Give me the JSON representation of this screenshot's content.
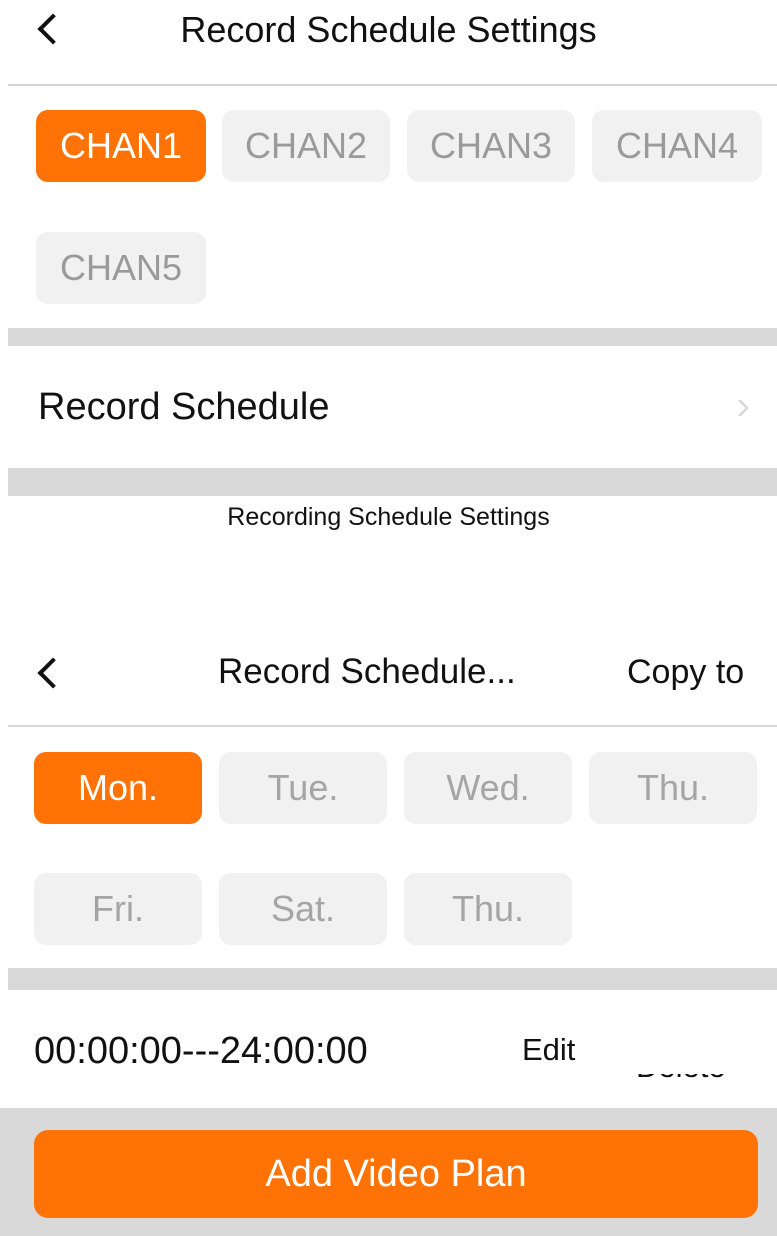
{
  "screen1": {
    "title": "Record Schedule Settings",
    "channels": [
      "CHAN1",
      "CHAN2",
      "CHAN3",
      "CHAN4",
      "CHAN5"
    ],
    "selected_channel": "CHAN1",
    "record_schedule_label": "Record Schedule"
  },
  "caption": "Recording Schedule Settings",
  "screen2": {
    "title": "Record Schedule...",
    "copy_to_label": "Copy to",
    "days": [
      "Mon.",
      "Tue.",
      "Wed.",
      "Thu.",
      "Fri.",
      "Sat.",
      "Thu."
    ],
    "selected_day": "Mon.",
    "schedule": {
      "time_range": "00:00:00---24:00:00",
      "edit_label": "Edit",
      "delete_label": "Delete"
    },
    "add_button_label": "Add Video Plan"
  },
  "colors": {
    "accent": "#ff7206",
    "chip_bg": "#f1f1f1",
    "chip_text": "#9a9a9a",
    "divider_band": "#d9d9d9"
  },
  "icons": {
    "back": "chevron-left-icon",
    "disclosure": "chevron-right-icon"
  }
}
